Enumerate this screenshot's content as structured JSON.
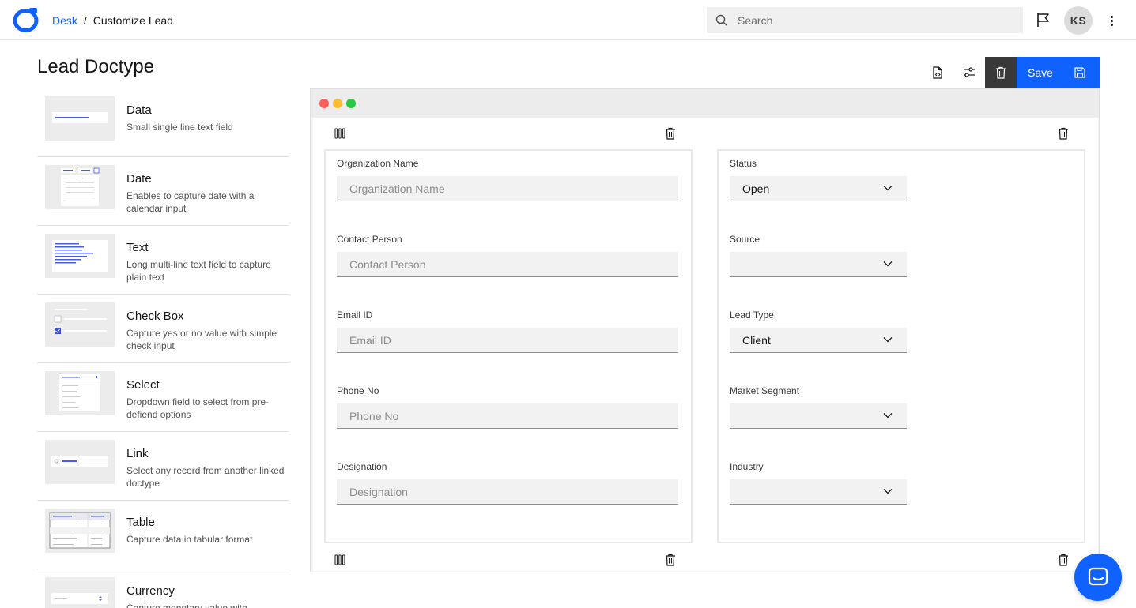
{
  "header": {
    "breadcrumb_root": "Desk",
    "breadcrumb_sep": "/",
    "breadcrumb_current": "Customize Lead",
    "search_placeholder": "Search",
    "avatar_initials": "KS",
    "brand_color": "#0f62fe"
  },
  "page": {
    "title": "Lead Doctype"
  },
  "palette": {
    "items": [
      {
        "name": "Data",
        "desc": "Small single line text field",
        "icon": "data-field-thumb"
      },
      {
        "name": "Date",
        "desc": "Enables to capture date with a calendar input",
        "icon": "date-field-thumb"
      },
      {
        "name": "Text",
        "desc": "Long multi-line text field to capture plain text",
        "icon": "text-field-thumb"
      },
      {
        "name": "Check Box",
        "desc": "Capture yes or no value with simple check input",
        "icon": "checkbox-field-thumb"
      },
      {
        "name": "Select",
        "desc": "Dropdown field to select from pre-defiend options",
        "icon": "select-field-thumb"
      },
      {
        "name": "Link",
        "desc": "Select any record from another linked doctype",
        "icon": "link-field-thumb"
      },
      {
        "name": "Table",
        "desc": "Capture data in tabular format",
        "icon": "table-field-thumb"
      },
      {
        "name": "Currency",
        "desc": "Capture monetary value with",
        "icon": "currency-field-thumb"
      }
    ]
  },
  "toolbar": {
    "save_label": "Save"
  },
  "form": {
    "left": [
      {
        "label": "Organization Name",
        "placeholder": "Organization Name"
      },
      {
        "label": "Contact Person",
        "placeholder": "Contact Person"
      },
      {
        "label": "Email ID",
        "placeholder": "Email ID"
      },
      {
        "label": "Phone No",
        "placeholder": "Phone No"
      },
      {
        "label": "Designation",
        "placeholder": "Designation"
      }
    ],
    "right": [
      {
        "label": "Status",
        "value": "Open"
      },
      {
        "label": "Source",
        "value": ""
      },
      {
        "label": "Lead Type",
        "value": "Client"
      },
      {
        "label": "Market Segment",
        "value": ""
      },
      {
        "label": "Industry",
        "value": ""
      }
    ]
  },
  "window_dots": {
    "red": "#ff5f57",
    "yellow": "#febc2e",
    "green": "#28c840"
  }
}
